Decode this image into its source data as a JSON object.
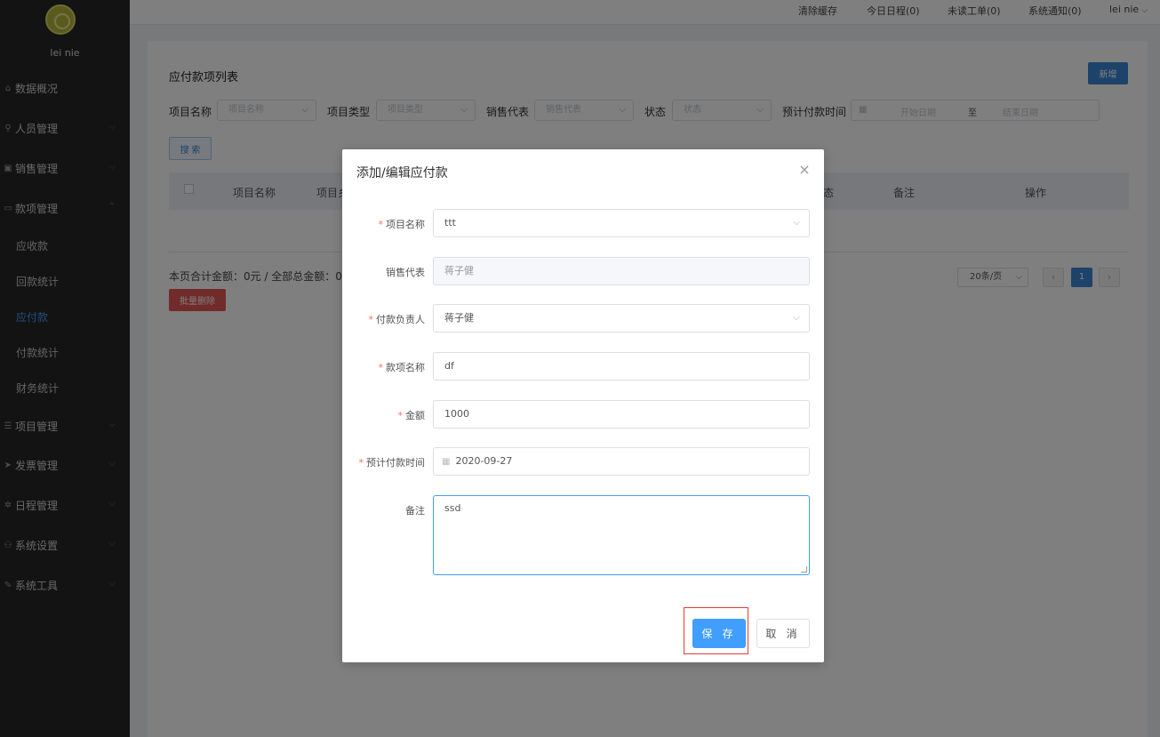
{
  "sidebar": {
    "username": "lei nie",
    "menu": [
      {
        "label": "数据概况",
        "icon": "home-icon"
      },
      {
        "label": "人员管理",
        "icon": "user-icon"
      },
      {
        "label": "销售管理",
        "icon": "cart-icon"
      },
      {
        "label": "款项管理",
        "icon": "card-icon"
      },
      {
        "label": "项目管理",
        "icon": "list-icon"
      },
      {
        "label": "发票管理",
        "icon": "send-icon"
      },
      {
        "label": "日程管理",
        "icon": "gear-icon"
      },
      {
        "label": "系统设置",
        "icon": "group-icon"
      },
      {
        "label": "系统工具",
        "icon": "wrench-icon"
      }
    ],
    "submenu": [
      "应收款",
      "回款统计",
      "应付款",
      "付款统计",
      "财务统计"
    ],
    "active_submenu": "应付款"
  },
  "topbar": {
    "clear_cache": "清除缓存",
    "today_schedule": "今日日程(0)",
    "unread_orders": "未读工单(0)",
    "system_notice": "系统通知(0)",
    "user": "lei nie"
  },
  "page": {
    "title": "应付款项列表",
    "new_button": "新增",
    "filters": {
      "project_name_label": "项目名称",
      "project_name_placeholder": "项目名称",
      "project_type_label": "项目类型",
      "project_type_placeholder": "项目类型",
      "sales_rep_label": "销售代表",
      "sales_rep_placeholder": "销售代表",
      "status_label": "状态",
      "status_placeholder": "状态",
      "planned_date_label": "预计付款时间",
      "start_date_placeholder": "开始日期",
      "range_separator": "至",
      "end_date_placeholder": "结束日期"
    },
    "search_button": "搜 索",
    "table_headers": {
      "project_name": "项目名称",
      "project_type_partial": "项目乡",
      "status_partial": "态",
      "remark": "备注",
      "action": "操作"
    },
    "summary": "本页合计金额：0元 / 全部总金额：0元",
    "batch_delete": "批量删除",
    "page_size": "20条/页",
    "current_page": "1"
  },
  "dialog": {
    "title": "添加/编辑应付款",
    "fields": {
      "project_name_label": "项目名称",
      "project_name_value": "ttt",
      "sales_rep_label": "销售代表",
      "sales_rep_value": "蒋子健",
      "payer_label": "付款负责人",
      "payer_value": "蒋子健",
      "item_name_label": "款项名称",
      "item_name_value": "df",
      "amount_label": "金额",
      "amount_value": "1000",
      "planned_date_label": "预计付款时间",
      "planned_date_value": "2020-09-27",
      "remark_label": "备注",
      "remark_value": "ssd"
    },
    "save_button": "保 存",
    "cancel_button": "取 消"
  },
  "colors": {
    "primary": "#409eff",
    "danger": "#e25656",
    "sidebar_bg": "#262626"
  }
}
